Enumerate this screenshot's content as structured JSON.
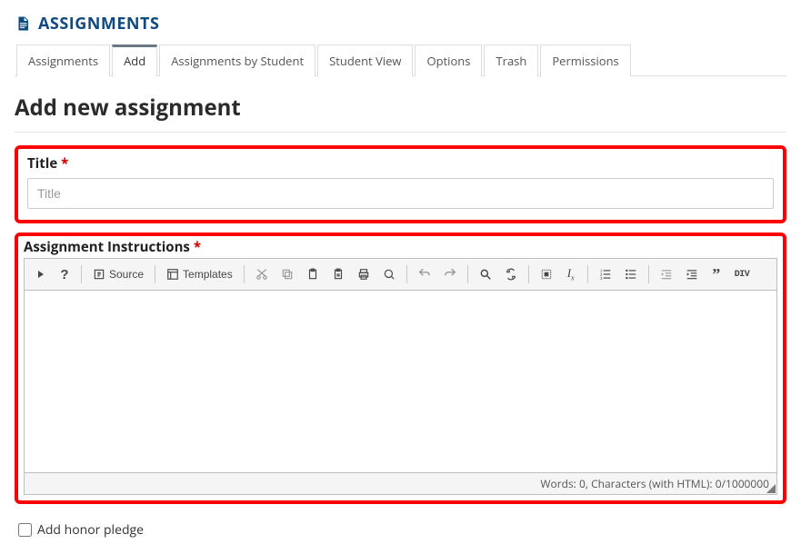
{
  "header": {
    "title": "ASSIGNMENTS"
  },
  "tabs": {
    "items": [
      {
        "label": "Assignments"
      },
      {
        "label": "Add"
      },
      {
        "label": "Assignments by Student"
      },
      {
        "label": "Student View"
      },
      {
        "label": "Options"
      },
      {
        "label": "Trash"
      },
      {
        "label": "Permissions"
      }
    ],
    "active_index": 1
  },
  "form": {
    "heading": "Add new assignment",
    "title_field": {
      "label": "Title",
      "placeholder": "Title",
      "value": ""
    },
    "instructions_field": {
      "label": "Assignment Instructions"
    },
    "honor_pledge": {
      "label": "Add honor pledge",
      "checked": false
    }
  },
  "editor": {
    "toolbar": {
      "source_label": "Source",
      "templates_label": "Templates"
    },
    "status": {
      "words_label": "Words",
      "words": 0,
      "chars_label": "Characters (with HTML)",
      "chars": 0,
      "chars_max": 1000000
    }
  }
}
